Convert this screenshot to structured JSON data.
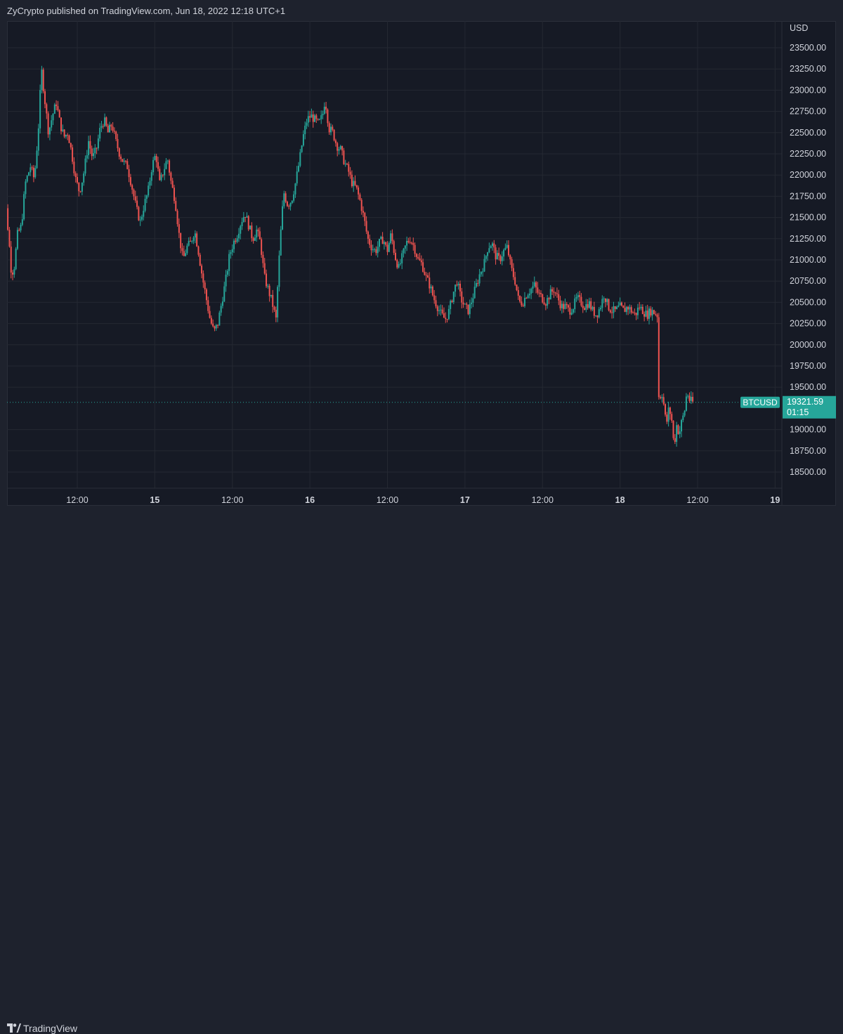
{
  "header": {
    "publisher_text": "ZyCrypto published on TradingView.com, Jun 18, 2022 12:18 UTC+1"
  },
  "footer": {
    "brand": "TradingView",
    "logo_icon": "tradingview-logo-icon"
  },
  "colors": {
    "background": "#161a25",
    "up": "#26a69a",
    "down": "#ef5350",
    "grid": "#242832",
    "price_label": "#26a69a"
  },
  "chart_data": {
    "type": "candlestick",
    "symbol": "BTCUSD",
    "currency_label": "USD",
    "last_price": "19321.59",
    "countdown": "01:15",
    "y_range": [
      18500,
      23600
    ],
    "y_ticks": [
      23500,
      23250,
      23000,
      22750,
      22500,
      22250,
      22000,
      21750,
      21500,
      21250,
      21000,
      20750,
      20500,
      20250,
      20000,
      19750,
      19500,
      19000,
      18750,
      18500
    ],
    "x_ticks": [
      {
        "label": "12:00",
        "t": 12,
        "bold": false
      },
      {
        "label": "15",
        "t": 24,
        "bold": true
      },
      {
        "label": "12:00",
        "t": 36,
        "bold": false
      },
      {
        "label": "16",
        "t": 48,
        "bold": true
      },
      {
        "label": "12:00",
        "t": 60,
        "bold": false
      },
      {
        "label": "17",
        "t": 72,
        "bold": true
      },
      {
        "label": "12:00",
        "t": 84,
        "bold": false
      },
      {
        "label": "18",
        "t": 96,
        "bold": true
      },
      {
        "label": "12:00",
        "t": 108,
        "bold": false
      },
      {
        "label": "19",
        "t": 120,
        "bold": true
      }
    ],
    "x_range_hours": [
      -5.2,
      120.2
    ],
    "price_path": [
      [
        0,
        22750
      ],
      [
        0.6,
        22300
      ],
      [
        1.0,
        21800
      ],
      [
        1.6,
        21300
      ],
      [
        2.0,
        20900
      ],
      [
        2.4,
        20850
      ],
      [
        3.0,
        21300
      ],
      [
        3.6,
        21400
      ],
      [
        4.2,
        21900
      ],
      [
        5.0,
        22100
      ],
      [
        5.6,
        21950
      ],
      [
        6.2,
        22500
      ],
      [
        6.7,
        23250
      ],
      [
        7.2,
        22900
      ],
      [
        7.8,
        22500
      ],
      [
        8.4,
        22700
      ],
      [
        9.0,
        22850
      ],
      [
        9.6,
        22600
      ],
      [
        10.2,
        22450
      ],
      [
        10.8,
        22500
      ],
      [
        11.4,
        22250
      ],
      [
        12.0,
        21950
      ],
      [
        12.6,
        21800
      ],
      [
        13.2,
        22000
      ],
      [
        14.0,
        22400
      ],
      [
        14.6,
        22200
      ],
      [
        15.2,
        22300
      ],
      [
        15.8,
        22550
      ],
      [
        16.4,
        22650
      ],
      [
        17.0,
        22500
      ],
      [
        17.6,
        22600
      ],
      [
        18.2,
        22400
      ],
      [
        18.8,
        22250
      ],
      [
        19.4,
        22150
      ],
      [
        20.0,
        22100
      ],
      [
        20.6,
        21900
      ],
      [
        21.4,
        21600
      ],
      [
        22.0,
        21450
      ],
      [
        22.6,
        21650
      ],
      [
        23.2,
        21800
      ],
      [
        23.8,
        22100
      ],
      [
        24.4,
        22250
      ],
      [
        25.0,
        21900
      ],
      [
        25.6,
        22050
      ],
      [
        26.2,
        22200
      ],
      [
        26.8,
        21900
      ],
      [
        27.4,
        21700
      ],
      [
        28.0,
        21300
      ],
      [
        28.6,
        21000
      ],
      [
        29.2,
        21150
      ],
      [
        29.8,
        21200
      ],
      [
        30.4,
        21350
      ],
      [
        31.0,
        21100
      ],
      [
        31.6,
        20800
      ],
      [
        32.2,
        20550
      ],
      [
        32.8,
        20300
      ],
      [
        33.4,
        20150
      ],
      [
        34.0,
        20250
      ],
      [
        34.6,
        20500
      ],
      [
        35.2,
        20750
      ],
      [
        35.8,
        21050
      ],
      [
        36.4,
        21200
      ],
      [
        37.0,
        21300
      ],
      [
        37.6,
        21450
      ],
      [
        38.2,
        21550
      ],
      [
        38.8,
        21400
      ],
      [
        39.4,
        21250
      ],
      [
        40.0,
        21350
      ],
      [
        40.6,
        21200
      ],
      [
        41.2,
        20800
      ],
      [
        41.8,
        20650
      ],
      [
        42.4,
        20500
      ],
      [
        43.0,
        20300
      ],
      [
        43.4,
        20900
      ],
      [
        43.8,
        21400
      ],
      [
        44.2,
        21800
      ],
      [
        44.8,
        21650
      ],
      [
        45.4,
        21700
      ],
      [
        46.0,
        21900
      ],
      [
        46.6,
        22150
      ],
      [
        47.2,
        22450
      ],
      [
        47.8,
        22650
      ],
      [
        48.4,
        22700
      ],
      [
        49.0,
        22650
      ],
      [
        49.6,
        22600
      ],
      [
        50.2,
        22700
      ],
      [
        50.6,
        22900
      ],
      [
        51.2,
        22550
      ],
      [
        51.8,
        22500
      ],
      [
        52.4,
        22350
      ],
      [
        53.0,
        22300
      ],
      [
        53.6,
        22150
      ],
      [
        54.2,
        22050
      ],
      [
        54.8,
        21900
      ],
      [
        55.4,
        21850
      ],
      [
        56.0,
        21700
      ],
      [
        56.6,
        21500
      ],
      [
        57.2,
        21250
      ],
      [
        57.8,
        21150
      ],
      [
        58.4,
        21100
      ],
      [
        59.0,
        21200
      ],
      [
        59.6,
        21250
      ],
      [
        60.2,
        21100
      ],
      [
        60.8,
        21300
      ],
      [
        61.4,
        21050
      ],
      [
        62.0,
        20900
      ],
      [
        62.6,
        21050
      ],
      [
        63.2,
        21200
      ],
      [
        63.8,
        21250
      ],
      [
        64.4,
        21150
      ],
      [
        65.0,
        21000
      ],
      [
        65.6,
        20950
      ],
      [
        66.2,
        20800
      ],
      [
        66.8,
        20700
      ],
      [
        67.4,
        20550
      ],
      [
        68.0,
        20450
      ],
      [
        68.6,
        20350
      ],
      [
        69.2,
        20300
      ],
      [
        69.8,
        20400
      ],
      [
        70.4,
        20600
      ],
      [
        71.0,
        20750
      ],
      [
        71.6,
        20550
      ],
      [
        72.2,
        20450
      ],
      [
        72.8,
        20400
      ],
      [
        73.4,
        20550
      ],
      [
        74.0,
        20700
      ],
      [
        74.6,
        20850
      ],
      [
        75.2,
        20950
      ],
      [
        75.8,
        21150
      ],
      [
        76.4,
        21200
      ],
      [
        77.0,
        21050
      ],
      [
        77.6,
        21000
      ],
      [
        78.2,
        21100
      ],
      [
        78.8,
        21150
      ],
      [
        79.4,
        20900
      ],
      [
        80.0,
        20750
      ],
      [
        80.6,
        20500
      ],
      [
        81.2,
        20500
      ],
      [
        81.8,
        20600
      ],
      [
        82.4,
        20650
      ],
      [
        83.0,
        20700
      ],
      [
        83.6,
        20600
      ],
      [
        84.2,
        20550
      ],
      [
        84.8,
        20500
      ],
      [
        85.4,
        20600
      ],
      [
        86.0,
        20650
      ],
      [
        86.6,
        20550
      ],
      [
        87.2,
        20450
      ],
      [
        87.8,
        20450
      ],
      [
        88.4,
        20400
      ],
      [
        89.0,
        20450
      ],
      [
        89.6,
        20550
      ],
      [
        90.2,
        20500
      ],
      [
        90.8,
        20450
      ],
      [
        91.4,
        20500
      ],
      [
        92.0,
        20400
      ],
      [
        92.6,
        20350
      ],
      [
        93.2,
        20450
      ],
      [
        93.8,
        20600
      ],
      [
        94.4,
        20450
      ],
      [
        95.0,
        20400
      ],
      [
        95.6,
        20400
      ],
      [
        96.2,
        20450
      ],
      [
        96.8,
        20400
      ],
      [
        97.4,
        20450
      ],
      [
        98.0,
        20400
      ],
      [
        98.6,
        20350
      ],
      [
        99.2,
        20450
      ],
      [
        99.8,
        20400
      ],
      [
        100.4,
        20350
      ],
      [
        101.0,
        20400
      ],
      [
        101.6,
        20380
      ],
      [
        102.0,
        20350
      ],
      [
        102.3,
        19200
      ],
      [
        102.6,
        19500
      ],
      [
        103.0,
        19300
      ],
      [
        103.4,
        19050
      ],
      [
        103.8,
        19250
      ],
      [
        104.2,
        19150
      ],
      [
        104.6,
        18800
      ],
      [
        105.0,
        19050
      ],
      [
        105.4,
        18950
      ],
      [
        105.8,
        19100
      ],
      [
        106.2,
        19200
      ],
      [
        106.6,
        19450
      ],
      [
        107.0,
        19350
      ],
      [
        107.4,
        19321
      ]
    ]
  }
}
